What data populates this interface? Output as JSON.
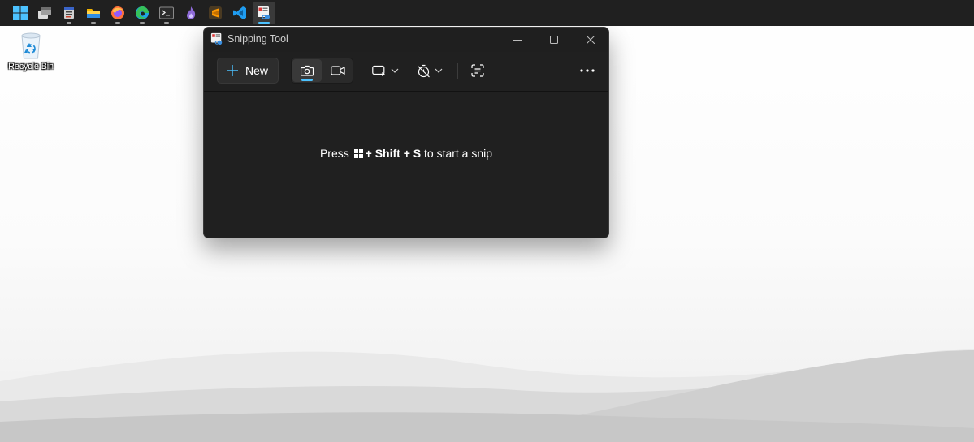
{
  "desktop": {
    "icons": [
      {
        "label": "Recycle Bin",
        "icon": "recycle-bin-icon"
      }
    ]
  },
  "taskbar": {
    "items": [
      {
        "name": "start",
        "icon": "windows-logo-icon"
      },
      {
        "name": "task-view",
        "icon": "task-view-icon"
      },
      {
        "name": "app-stack",
        "icon": "app-stack-icon"
      },
      {
        "name": "file-explorer",
        "icon": "folder-icon"
      },
      {
        "name": "firefox",
        "icon": "firefox-icon"
      },
      {
        "name": "edge",
        "icon": "edge-icon"
      },
      {
        "name": "terminal",
        "icon": "terminal-icon"
      },
      {
        "name": "purple-app",
        "icon": "flame-app-icon"
      },
      {
        "name": "sublime-text",
        "icon": "sublime-icon"
      },
      {
        "name": "vscode",
        "icon": "vscode-icon"
      },
      {
        "name": "snipping-tool",
        "icon": "snipping-tool-icon",
        "active": true
      }
    ]
  },
  "window": {
    "title": "Snipping Tool",
    "toolbar": {
      "new_label": "New"
    },
    "hint": {
      "prefix": "Press",
      "shortcut": "+ Shift + S",
      "suffix": "to start a snip"
    }
  },
  "colors": {
    "accent": "#4cc2ff",
    "window_bg": "#202020",
    "taskbar_bg": "#202020"
  }
}
